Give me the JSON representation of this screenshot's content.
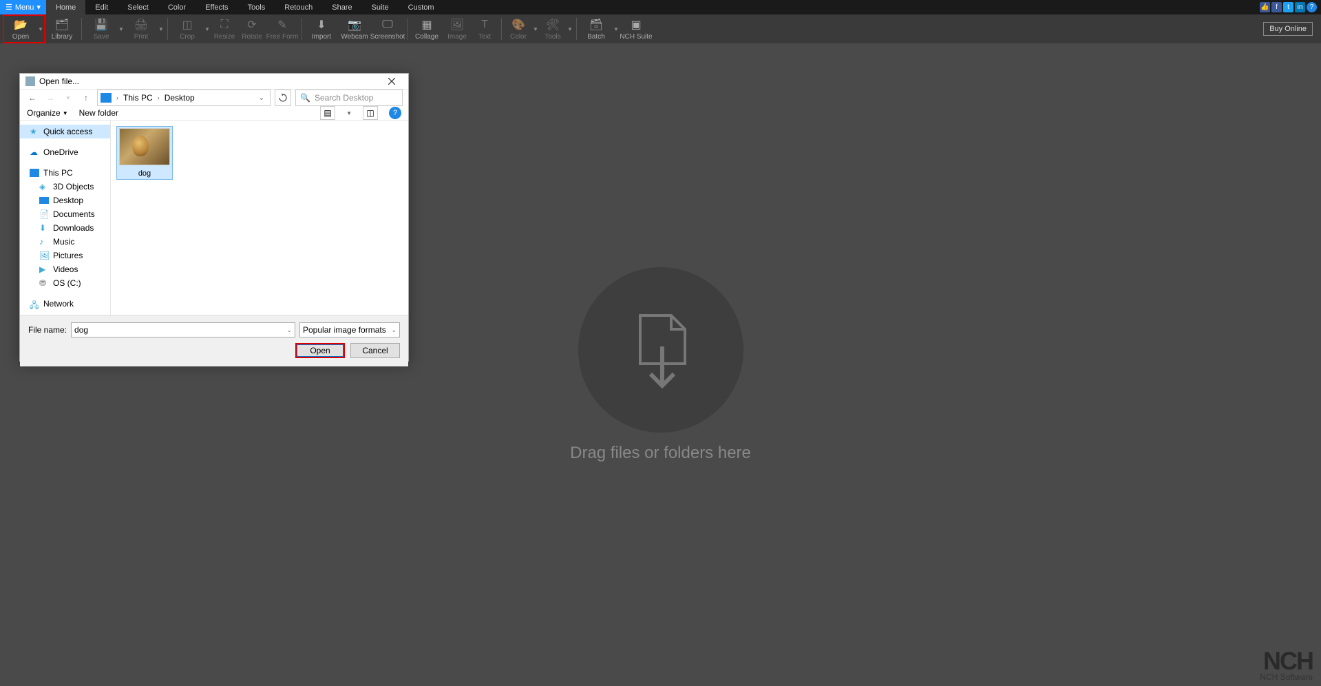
{
  "menubar": {
    "menu_label": "Menu",
    "items": [
      "Home",
      "Edit",
      "Select",
      "Color",
      "Effects",
      "Tools",
      "Retouch",
      "Share",
      "Suite",
      "Custom"
    ],
    "active_index": 0
  },
  "ribbon": {
    "open": "Open",
    "library": "Library",
    "save": "Save",
    "print": "Print",
    "crop": "Crop",
    "resize": "Resize",
    "rotate": "Rotate",
    "freeform": "Free Form",
    "import": "Import",
    "webcam": "Webcam",
    "screenshot": "Screenshot",
    "collage": "Collage",
    "image": "Image",
    "text": "Text",
    "color": "Color",
    "tools": "Tools",
    "batch": "Batch",
    "nchsuite": "NCH Suite",
    "buy_online": "Buy Online"
  },
  "canvas": {
    "drop_text": "Drag files or folders here",
    "watermark_brand": "NCH",
    "watermark_sub": "NCH Software"
  },
  "dialog": {
    "title": "Open file...",
    "breadcrumb": {
      "root_icon": "pc",
      "seg1": "This PC",
      "seg2": "Desktop"
    },
    "search_placeholder": "Search Desktop",
    "toolbar": {
      "organize": "Organize",
      "newfolder": "New folder"
    },
    "tree": {
      "quick_access": "Quick access",
      "onedrive": "OneDrive",
      "this_pc": "This PC",
      "d3d": "3D Objects",
      "desktop": "Desktop",
      "documents": "Documents",
      "downloads": "Downloads",
      "music": "Music",
      "pictures": "Pictures",
      "videos": "Videos",
      "osc": "OS (C:)",
      "network": "Network"
    },
    "files": [
      {
        "name": "dog"
      }
    ],
    "footer": {
      "filename_label": "File name:",
      "filename_value": "dog",
      "filter_label": "Popular image formats",
      "open": "Open",
      "cancel": "Cancel"
    }
  }
}
